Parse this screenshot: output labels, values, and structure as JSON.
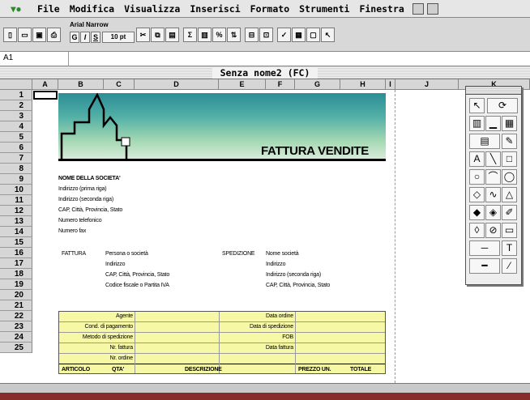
{
  "menubar": {
    "items": [
      "File",
      "Modifica",
      "Visualizza",
      "Inserisci",
      "Formato",
      "Strumenti",
      "Finestra"
    ]
  },
  "toolbar": {
    "font_name": "Arial Narrow",
    "font_size": "10 pt",
    "bold": "G",
    "italic": "I",
    "underline": "S",
    "sum": "Σ",
    "percent": "%"
  },
  "formula_bar": {
    "cell_ref": "A1"
  },
  "window": {
    "title": "Senza nome2  (FC)"
  },
  "columns": [
    "A",
    "B",
    "C",
    "D",
    "E",
    "F",
    "G",
    "H",
    "I",
    "J",
    "K"
  ],
  "rows": [
    "1",
    "2",
    "3",
    "4",
    "5",
    "6",
    "7",
    "8",
    "9",
    "10",
    "11",
    "12",
    "13",
    "14",
    "15",
    "16",
    "17",
    "18",
    "19",
    "20",
    "21",
    "22",
    "23",
    "24",
    "25"
  ],
  "invoice": {
    "title": "FATTURA VENDITE",
    "company": "NOME DELLA SOCIETA'",
    "address_lines": [
      "Indirizzo (prima riga)",
      "Indirizzo (seconda riga)",
      "CAP, Città, Provincia, Stato",
      "Numero telefonico",
      "Numero fax"
    ],
    "bill_label": "FATTURA",
    "bill_lines": [
      "Persona o società",
      "Indirizzo",
      "CAP, Città, Provincia, Stato",
      "Codice fiscale o Partita IVA"
    ],
    "ship_label": "SPEDIZIONE",
    "ship_lines": [
      "Nome società",
      "Indirizzo",
      "Indirizzo (seconda riga)",
      "CAP, Città, Provincia, Stato"
    ],
    "left_fields": [
      "Agente",
      "Cond. di pagamento",
      "Metodo di spedizione",
      "Nr. fattura",
      "Nr. ordine"
    ],
    "right_fields": [
      "Data ordine",
      "Data di spedizione",
      "FOB",
      "Data fattura"
    ],
    "table_headers": [
      "ARTICOLO",
      "QTA'",
      "DESCRIZIONE",
      "PREZZO UN.",
      "TOTALE"
    ]
  },
  "colors": {
    "banner_top": "#2b8d96",
    "box_fill": "#f6f8a6"
  }
}
